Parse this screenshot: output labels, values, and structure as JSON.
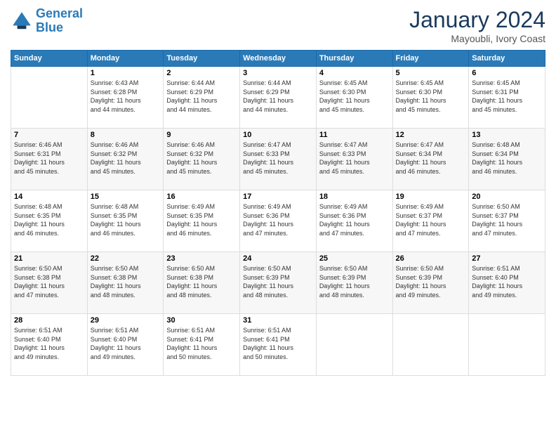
{
  "logo": {
    "line1": "General",
    "line2": "Blue"
  },
  "title": "January 2024",
  "subtitle": "Mayoubli, Ivory Coast",
  "days_of_week": [
    "Sunday",
    "Monday",
    "Tuesday",
    "Wednesday",
    "Thursday",
    "Friday",
    "Saturday"
  ],
  "weeks": [
    [
      {
        "day": "",
        "info": ""
      },
      {
        "day": "1",
        "info": "Sunrise: 6:43 AM\nSunset: 6:28 PM\nDaylight: 11 hours\nand 44 minutes."
      },
      {
        "day": "2",
        "info": "Sunrise: 6:44 AM\nSunset: 6:29 PM\nDaylight: 11 hours\nand 44 minutes."
      },
      {
        "day": "3",
        "info": "Sunrise: 6:44 AM\nSunset: 6:29 PM\nDaylight: 11 hours\nand 44 minutes."
      },
      {
        "day": "4",
        "info": "Sunrise: 6:45 AM\nSunset: 6:30 PM\nDaylight: 11 hours\nand 45 minutes."
      },
      {
        "day": "5",
        "info": "Sunrise: 6:45 AM\nSunset: 6:30 PM\nDaylight: 11 hours\nand 45 minutes."
      },
      {
        "day": "6",
        "info": "Sunrise: 6:45 AM\nSunset: 6:31 PM\nDaylight: 11 hours\nand 45 minutes."
      }
    ],
    [
      {
        "day": "7",
        "info": "Sunrise: 6:46 AM\nSunset: 6:31 PM\nDaylight: 11 hours\nand 45 minutes."
      },
      {
        "day": "8",
        "info": "Sunrise: 6:46 AM\nSunset: 6:32 PM\nDaylight: 11 hours\nand 45 minutes."
      },
      {
        "day": "9",
        "info": "Sunrise: 6:46 AM\nSunset: 6:32 PM\nDaylight: 11 hours\nand 45 minutes."
      },
      {
        "day": "10",
        "info": "Sunrise: 6:47 AM\nSunset: 6:33 PM\nDaylight: 11 hours\nand 45 minutes."
      },
      {
        "day": "11",
        "info": "Sunrise: 6:47 AM\nSunset: 6:33 PM\nDaylight: 11 hours\nand 45 minutes."
      },
      {
        "day": "12",
        "info": "Sunrise: 6:47 AM\nSunset: 6:34 PM\nDaylight: 11 hours\nand 46 minutes."
      },
      {
        "day": "13",
        "info": "Sunrise: 6:48 AM\nSunset: 6:34 PM\nDaylight: 11 hours\nand 46 minutes."
      }
    ],
    [
      {
        "day": "14",
        "info": "Sunrise: 6:48 AM\nSunset: 6:35 PM\nDaylight: 11 hours\nand 46 minutes."
      },
      {
        "day": "15",
        "info": "Sunrise: 6:48 AM\nSunset: 6:35 PM\nDaylight: 11 hours\nand 46 minutes."
      },
      {
        "day": "16",
        "info": "Sunrise: 6:49 AM\nSunset: 6:35 PM\nDaylight: 11 hours\nand 46 minutes."
      },
      {
        "day": "17",
        "info": "Sunrise: 6:49 AM\nSunset: 6:36 PM\nDaylight: 11 hours\nand 47 minutes."
      },
      {
        "day": "18",
        "info": "Sunrise: 6:49 AM\nSunset: 6:36 PM\nDaylight: 11 hours\nand 47 minutes."
      },
      {
        "day": "19",
        "info": "Sunrise: 6:49 AM\nSunset: 6:37 PM\nDaylight: 11 hours\nand 47 minutes."
      },
      {
        "day": "20",
        "info": "Sunrise: 6:50 AM\nSunset: 6:37 PM\nDaylight: 11 hours\nand 47 minutes."
      }
    ],
    [
      {
        "day": "21",
        "info": "Sunrise: 6:50 AM\nSunset: 6:38 PM\nDaylight: 11 hours\nand 47 minutes."
      },
      {
        "day": "22",
        "info": "Sunrise: 6:50 AM\nSunset: 6:38 PM\nDaylight: 11 hours\nand 48 minutes."
      },
      {
        "day": "23",
        "info": "Sunrise: 6:50 AM\nSunset: 6:38 PM\nDaylight: 11 hours\nand 48 minutes."
      },
      {
        "day": "24",
        "info": "Sunrise: 6:50 AM\nSunset: 6:39 PM\nDaylight: 11 hours\nand 48 minutes."
      },
      {
        "day": "25",
        "info": "Sunrise: 6:50 AM\nSunset: 6:39 PM\nDaylight: 11 hours\nand 48 minutes."
      },
      {
        "day": "26",
        "info": "Sunrise: 6:50 AM\nSunset: 6:39 PM\nDaylight: 11 hours\nand 49 minutes."
      },
      {
        "day": "27",
        "info": "Sunrise: 6:51 AM\nSunset: 6:40 PM\nDaylight: 11 hours\nand 49 minutes."
      }
    ],
    [
      {
        "day": "28",
        "info": "Sunrise: 6:51 AM\nSunset: 6:40 PM\nDaylight: 11 hours\nand 49 minutes."
      },
      {
        "day": "29",
        "info": "Sunrise: 6:51 AM\nSunset: 6:40 PM\nDaylight: 11 hours\nand 49 minutes."
      },
      {
        "day": "30",
        "info": "Sunrise: 6:51 AM\nSunset: 6:41 PM\nDaylight: 11 hours\nand 50 minutes."
      },
      {
        "day": "31",
        "info": "Sunrise: 6:51 AM\nSunset: 6:41 PM\nDaylight: 11 hours\nand 50 minutes."
      },
      {
        "day": "",
        "info": ""
      },
      {
        "day": "",
        "info": ""
      },
      {
        "day": "",
        "info": ""
      }
    ]
  ]
}
